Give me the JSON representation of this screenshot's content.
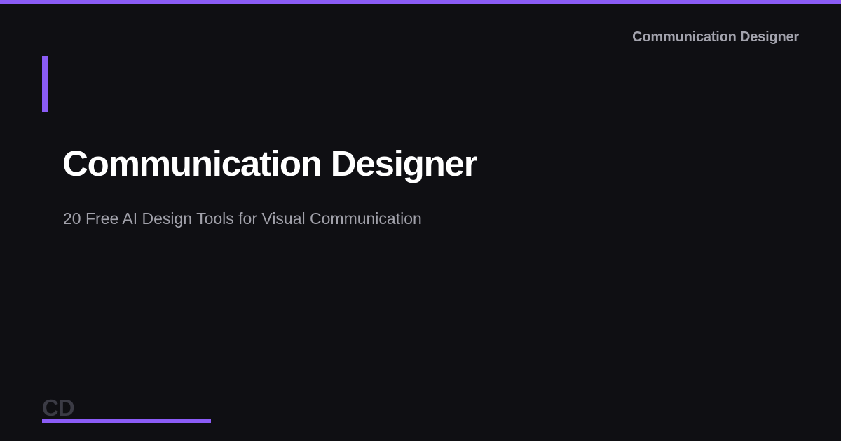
{
  "header": {
    "brand": "Communication Designer"
  },
  "hero": {
    "title": "Communication Designer",
    "subtitle": "20 Free AI Design Tools for Visual Communication"
  },
  "footer": {
    "logo": "CD"
  },
  "colors": {
    "background": "#0f0f13",
    "accent": "#8b5cf6",
    "title": "#ffffff",
    "subtitle": "#a1a1aa",
    "brand_text": "#a3a3ad",
    "logo_text": "#3b3b45"
  }
}
